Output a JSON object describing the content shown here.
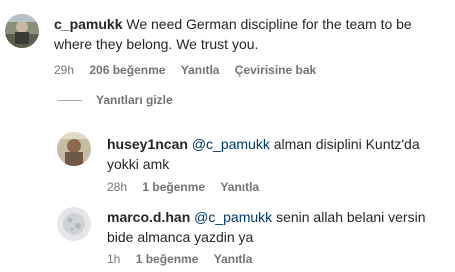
{
  "comments": [
    {
      "username": "c_pamukk",
      "text": "We need German discipline for the team to be where they belong. We trust you.",
      "time": "29h",
      "likes": "206 beğenme",
      "reply": "Yanıtla",
      "translate": "Çevirisine bak"
    }
  ],
  "replies_toggle": "Yanıtları gizle",
  "replies": [
    {
      "username": "husey1ncan",
      "mention": "@c_pamukk",
      "text": "alman disiplini Kuntz'da yokki amk",
      "time": "28h",
      "likes": "1 beğenme",
      "reply": "Yanıtla"
    },
    {
      "username": "marco.d.han",
      "mention": "@c_pamukk",
      "text": "senin allah belani versin bide almanca yazdin ya",
      "time": "1h",
      "likes": "1 beğenme",
      "reply": "Yanıtla"
    }
  ]
}
